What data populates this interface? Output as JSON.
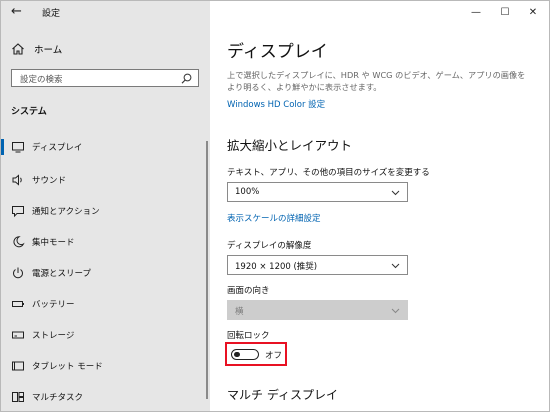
{
  "window": {
    "title": "設定",
    "back_icon": "←",
    "controls": [
      "—",
      "☐",
      "✕"
    ]
  },
  "sidebar": {
    "home_label": "ホーム",
    "search_placeholder": "設定の検索",
    "section_label": "システム",
    "items": [
      {
        "label": "ディスプレイ",
        "icon": "display-icon",
        "active": true
      },
      {
        "label": "サウンド",
        "icon": "sound-icon"
      },
      {
        "label": "通知とアクション",
        "icon": "notification-icon"
      },
      {
        "label": "集中モード",
        "icon": "focus-moon-icon"
      },
      {
        "label": "電源とスリープ",
        "icon": "power-icon"
      },
      {
        "label": "バッテリー",
        "icon": "battery-icon"
      },
      {
        "label": "ストレージ",
        "icon": "storage-icon"
      },
      {
        "label": "タブレット モード",
        "icon": "tablet-icon"
      },
      {
        "label": "マルチタスク",
        "icon": "multitask-icon"
      }
    ]
  },
  "main": {
    "title": "ディスプレイ",
    "description": "上で選択したディスプレイに、HDR や WCG のビデオ、ゲーム、アプリの画像をより明るく、より鮮やかに表示させます。",
    "hdr_link": "Windows HD Color 設定",
    "scale_section": "拡大縮小とレイアウト",
    "scale_label": "テキスト、アプリ、その他の項目のサイズを変更する",
    "scale_value": "100%",
    "scale_link": "表示スケールの詳細設定",
    "resolution_label": "ディスプレイの解像度",
    "resolution_value": "1920 × 1200 (推奨)",
    "orientation_label": "画面の向き",
    "orientation_value": "横",
    "rotation_lock_label": "回転ロック",
    "rotation_lock_state": "オフ",
    "multi_display_section": "マルチ ディスプレイ"
  },
  "colors": {
    "accent": "#0063b1",
    "highlight_box": "#e81123",
    "sidebar_bg": "#e6e6e6"
  }
}
